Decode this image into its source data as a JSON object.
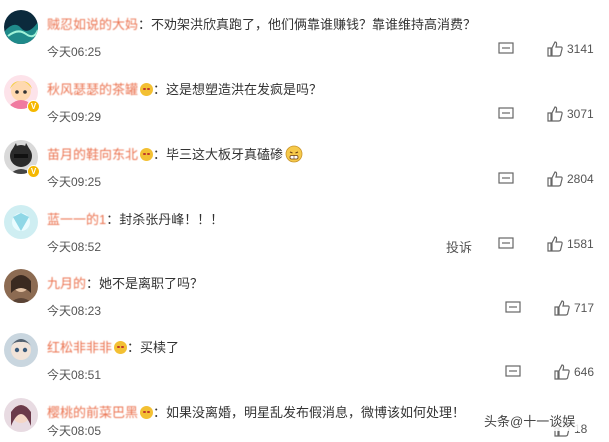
{
  "comments": [
    {
      "username": "贼忍如说的大妈",
      "text": "不劝架洪欣真跑了，他们俩靠谁赚钱？靠谁维持高消费？",
      "time": "今天06:25",
      "likes": "3141"
    },
    {
      "username": "秋风瑟瑟的茶罐",
      "text": "这是想塑造洪在发疯是吗？",
      "time": "今天09:29",
      "likes": "3071"
    },
    {
      "username": "苗月的鞋向东北",
      "text": "毕三这大板牙真磕碜",
      "time": "今天09:25",
      "likes": "2804"
    },
    {
      "username": "蓝一一的1",
      "text": "封杀张丹峰！！！",
      "time": "今天08:52",
      "likes": "1581",
      "report": "投诉"
    },
    {
      "username": "九月的",
      "text": "她不是离职了吗？",
      "time": "今天08:23",
      "likes": "717"
    },
    {
      "username": "红松非非非",
      "text": "买椟了",
      "time": "今天08:51",
      "likes": "646"
    },
    {
      "username": "樱桃的前菜巴黑",
      "text": "如果没离婚，明星乱发布假消息，微博该如何处理！",
      "time": "今天08:05",
      "likes": "18"
    }
  ],
  "colon": "：",
  "watermark": "头条@十一谈娱",
  "colors": {
    "username": "#eb7350",
    "text": "#333333",
    "meta": "#555555",
    "badge": "#f5b800"
  },
  "icons": {
    "reply": "reply-icon",
    "like": "thumbs-up-icon"
  }
}
